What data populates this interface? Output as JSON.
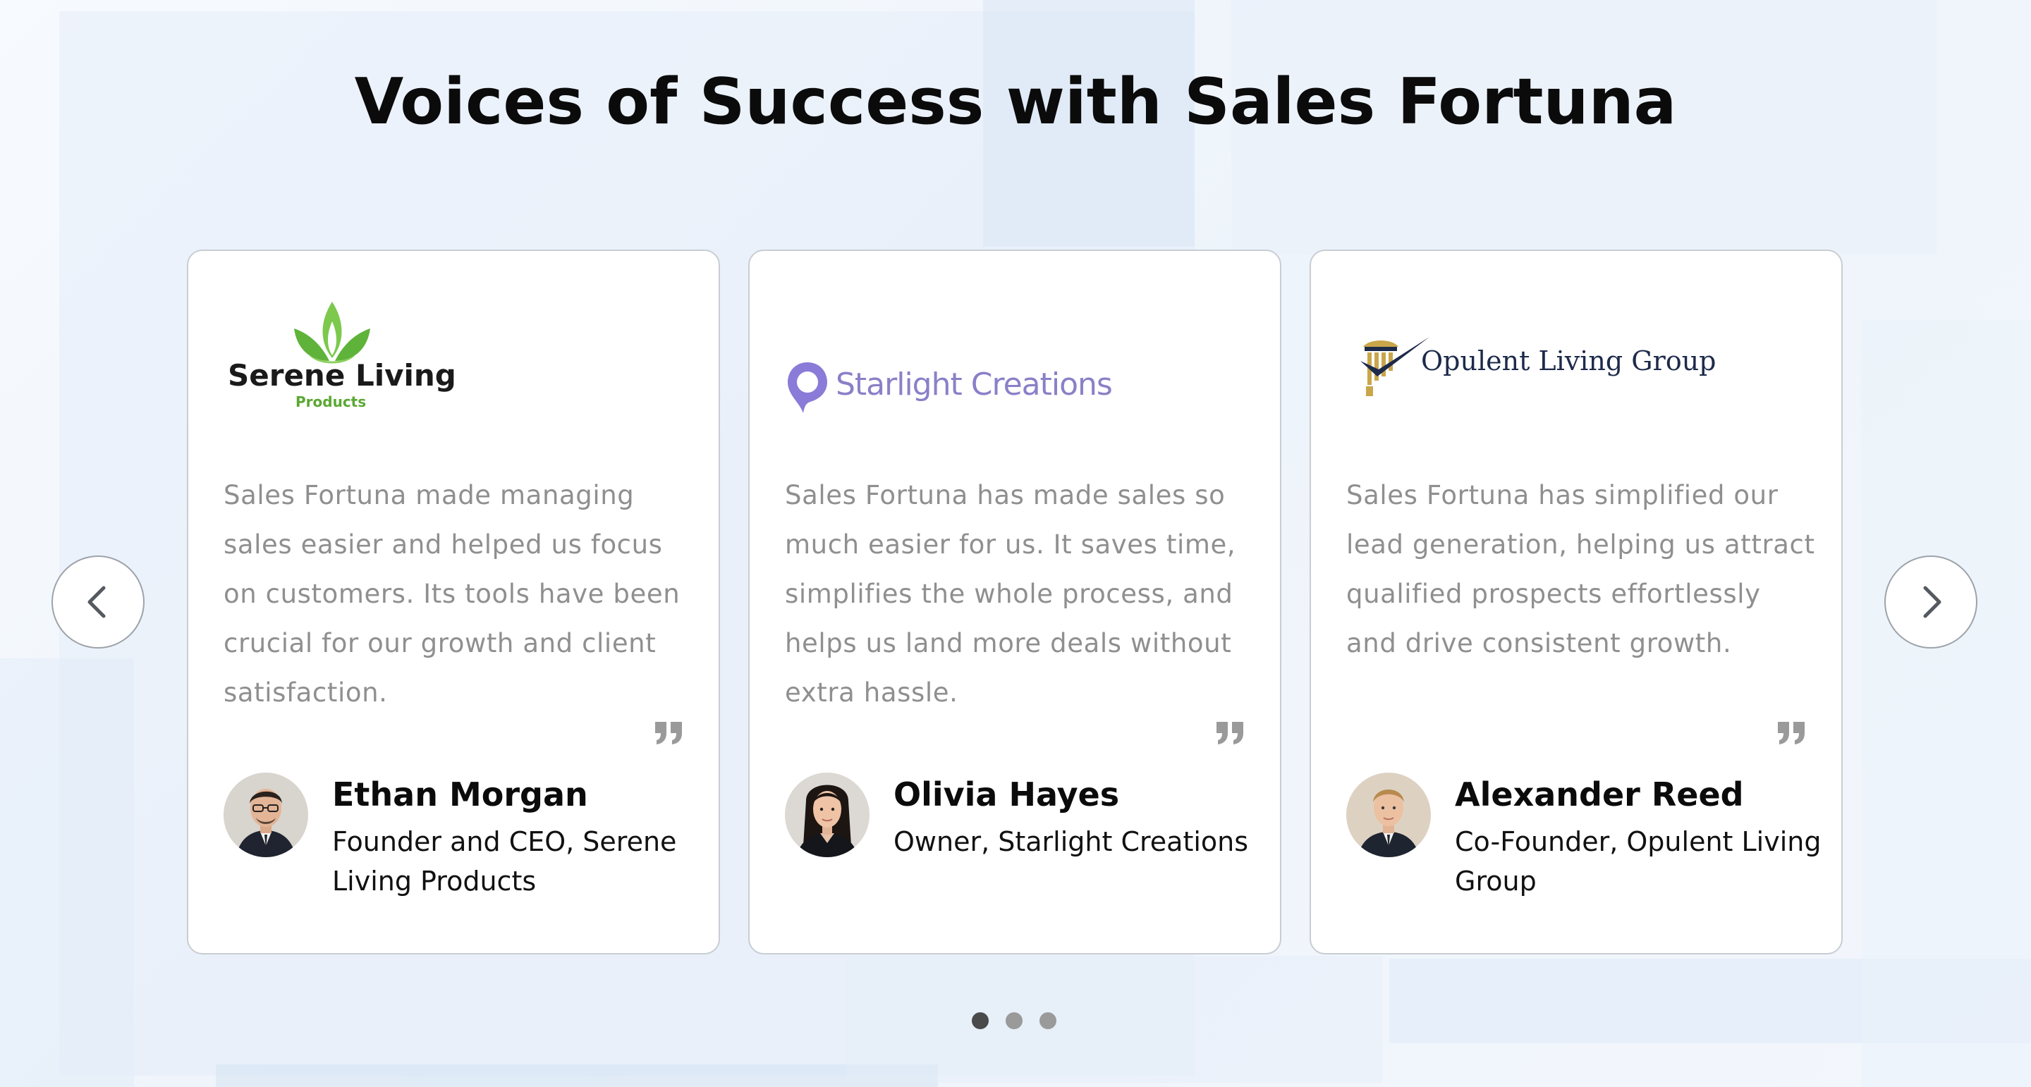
{
  "heading": "Voices of Success with Sales Fortuna",
  "testimonials": [
    {
      "logo": {
        "line1": "Serene Living",
        "line2": "Products",
        "icon": "leaf-lotus-icon",
        "colors": {
          "leaf": "#6cc04a",
          "text": "#1a1a1a",
          "sub": "#5aa832"
        }
      },
      "quote": "Sales Fortuna made managing sales easier and helped us focus on customers. Its tools have been crucial for our growth and client satisfaction.",
      "name": "Ethan Morgan",
      "role": "Founder and CEO, Serene Living Products"
    },
    {
      "logo": {
        "line1": "Starlight Creations",
        "icon": "location-pin-icon",
        "colors": {
          "pin": "#8b7bd8",
          "text": "#8a80c8"
        }
      },
      "quote": "Sales Fortuna has made sales so much easier for us. It saves time, simplifies the whole process, and helps us land more deals without extra hassle.",
      "name": "Olivia Hayes",
      "role": "Owner, Starlight Creations"
    },
    {
      "logo": {
        "line1": "Opulent Living Group",
        "icon": "column-check-icon",
        "colors": {
          "gold": "#c9a64a",
          "navy": "#1d2a4a",
          "text": "#1d2a4a"
        }
      },
      "quote": "Sales Fortuna has simplified our lead generation, helping us attract qualified prospects effortlessly and drive consistent growth.",
      "name": "Alexander Reed",
      "role": "Co-Founder, Opulent Living Group"
    }
  ],
  "carousel": {
    "prev_icon": "chevron-left-icon",
    "next_icon": "chevron-right-icon",
    "active_page": 1,
    "total_pages": 3
  },
  "colors": {
    "quote_text": "#8f8f8f",
    "quote_mark": "#9a9a9a",
    "dot_active": "#4a4a4a",
    "dot_inactive": "#9a9a9a"
  }
}
